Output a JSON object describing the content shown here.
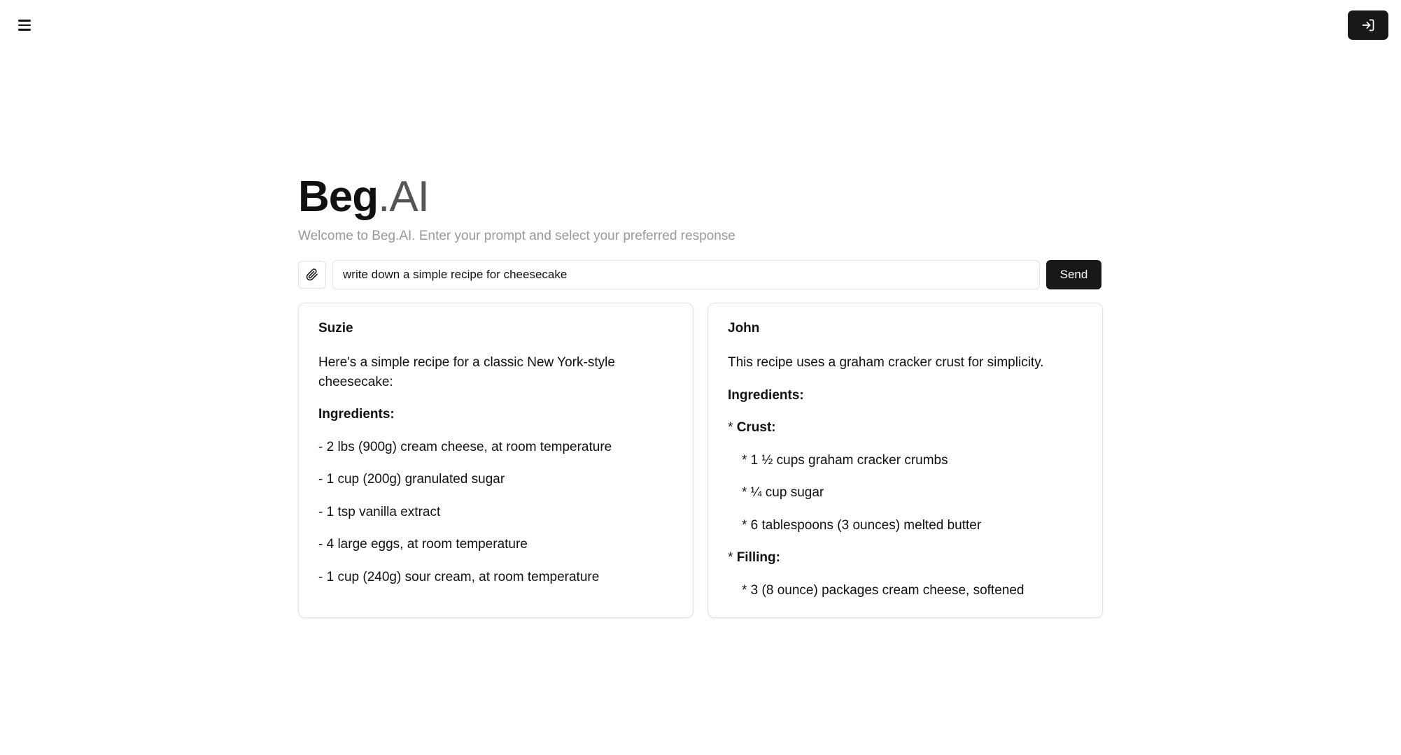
{
  "header": {
    "menu_icon": "hamburger-menu-icon",
    "login_icon": "sign-in-icon"
  },
  "brand": {
    "name_bold": "Beg",
    "name_light": ".AI"
  },
  "subtitle": "Welcome to Beg.AI. Enter your prompt and select your preferred response",
  "prompt": {
    "attach_icon": "paperclip-icon",
    "value": "write down a simple recipe for cheesecake",
    "send_label": "Send"
  },
  "responses": [
    {
      "name": "Suzie",
      "intro": "Here's a simple recipe for a classic New York-style cheesecake:",
      "heading": "Ingredients:",
      "items": [
        "- 2 lbs (900g) cream cheese, at room temperature",
        "- 1 cup (200g) granulated sugar",
        "- 1 tsp vanilla extract",
        "- 4 large eggs, at room temperature",
        "- 1 cup (240g) sour cream, at room temperature"
      ]
    },
    {
      "name": "John",
      "intro": "This recipe uses a graham cracker crust for simplicity.",
      "heading": "Ingredients:",
      "crust": {
        "bullet": "* ",
        "label": "Crust:",
        "items": [
          "* 1 ½ cups graham cracker crumbs",
          "* ¼ cup sugar",
          "* 6 tablespoons (3 ounces) melted butter"
        ]
      },
      "filling": {
        "bullet": "* ",
        "label": "Filling:",
        "items": [
          "* 3 (8 ounce) packages cream cheese, softened"
        ]
      }
    }
  ]
}
